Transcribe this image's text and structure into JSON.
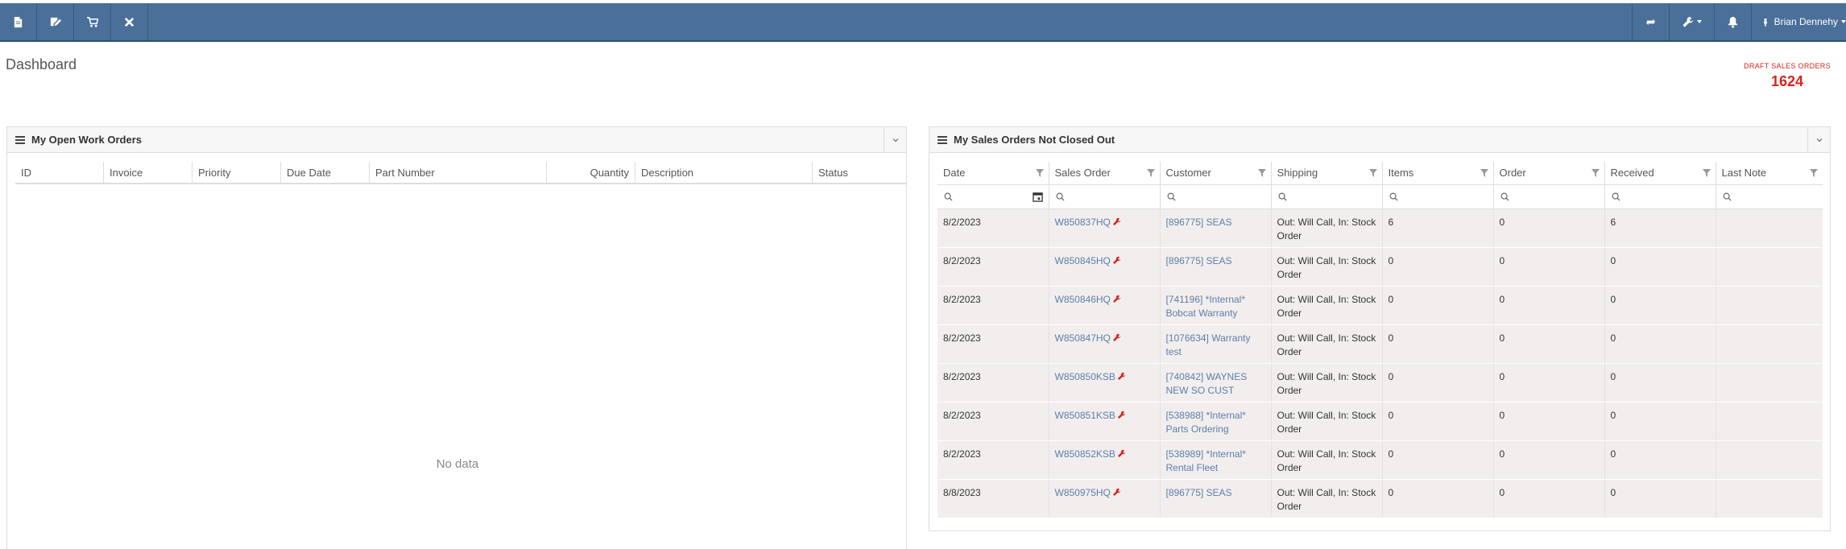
{
  "navbar": {
    "left_icons": [
      "document-icon",
      "edit-document-icon",
      "cart-icon",
      "tools-icon"
    ],
    "user_name": "Brian Dennehy"
  },
  "page": {
    "title": "Dashboard"
  },
  "draft_sales_orders": {
    "label": "DRAFT SALES ORDERS",
    "count": "1624"
  },
  "work_orders": {
    "title": "My Open Work Orders",
    "columns": [
      "ID",
      "Invoice",
      "Priority",
      "Due Date",
      "Part Number",
      "Quantity",
      "Description",
      "Status"
    ],
    "empty_text": "No data"
  },
  "sales_orders": {
    "title": "My Sales Orders Not Closed Out",
    "columns": [
      "Date",
      "Sales Order",
      "Customer",
      "Shipping",
      "Items",
      "Order",
      "Received",
      "Last Note"
    ],
    "rows": [
      {
        "date": "8/2/2023",
        "order": "W850837HQ",
        "customer": "[896775] SEAS",
        "shipping": "Out: Will Call, In: Stock Order",
        "items": "6",
        "order_qty": "0",
        "received": "6",
        "last_note": ""
      },
      {
        "date": "8/2/2023",
        "order": "W850845HQ",
        "customer": "[896775] SEAS",
        "shipping": "Out: Will Call, In: Stock Order",
        "items": "0",
        "order_qty": "0",
        "received": "0",
        "last_note": ""
      },
      {
        "date": "8/2/2023",
        "order": "W850846HQ",
        "customer": "[741196] *Internal* Bobcat Warranty",
        "shipping": "Out: Will Call, In: Stock Order",
        "items": "0",
        "order_qty": "0",
        "received": "0",
        "last_note": ""
      },
      {
        "date": "8/2/2023",
        "order": "W850847HQ",
        "customer": "[1076634] Warranty test",
        "shipping": "Out: Will Call, In: Stock Order",
        "items": "0",
        "order_qty": "0",
        "received": "0",
        "last_note": ""
      },
      {
        "date": "8/2/2023",
        "order": "W850850KSB",
        "customer": "[740842] WAYNES NEW SO CUST",
        "shipping": "Out: Will Call, In: Stock Order",
        "items": "0",
        "order_qty": "0",
        "received": "0",
        "last_note": ""
      },
      {
        "date": "8/2/2023",
        "order": "W850851KSB",
        "customer": "[538988] *Internal* Parts Ordering",
        "shipping": "Out: Will Call, In: Stock Order",
        "items": "0",
        "order_qty": "0",
        "received": "0",
        "last_note": ""
      },
      {
        "date": "8/2/2023",
        "order": "W850852KSB",
        "customer": "[538989] *Internal* Rental Fleet",
        "shipping": "Out: Will Call, In: Stock Order",
        "items": "0",
        "order_qty": "0",
        "received": "0",
        "last_note": ""
      },
      {
        "date": "8/8/2023",
        "order": "W850975HQ",
        "customer": "[896775] SEAS",
        "shipping": "Out: Will Call, In: Stock Order",
        "items": "0",
        "order_qty": "0",
        "received": "0",
        "last_note": ""
      }
    ]
  },
  "colors": {
    "navbar": "#4a7099",
    "accent_red": "#d9231a",
    "link": "#5a7fa8",
    "row_bg": "#f3eeee"
  }
}
